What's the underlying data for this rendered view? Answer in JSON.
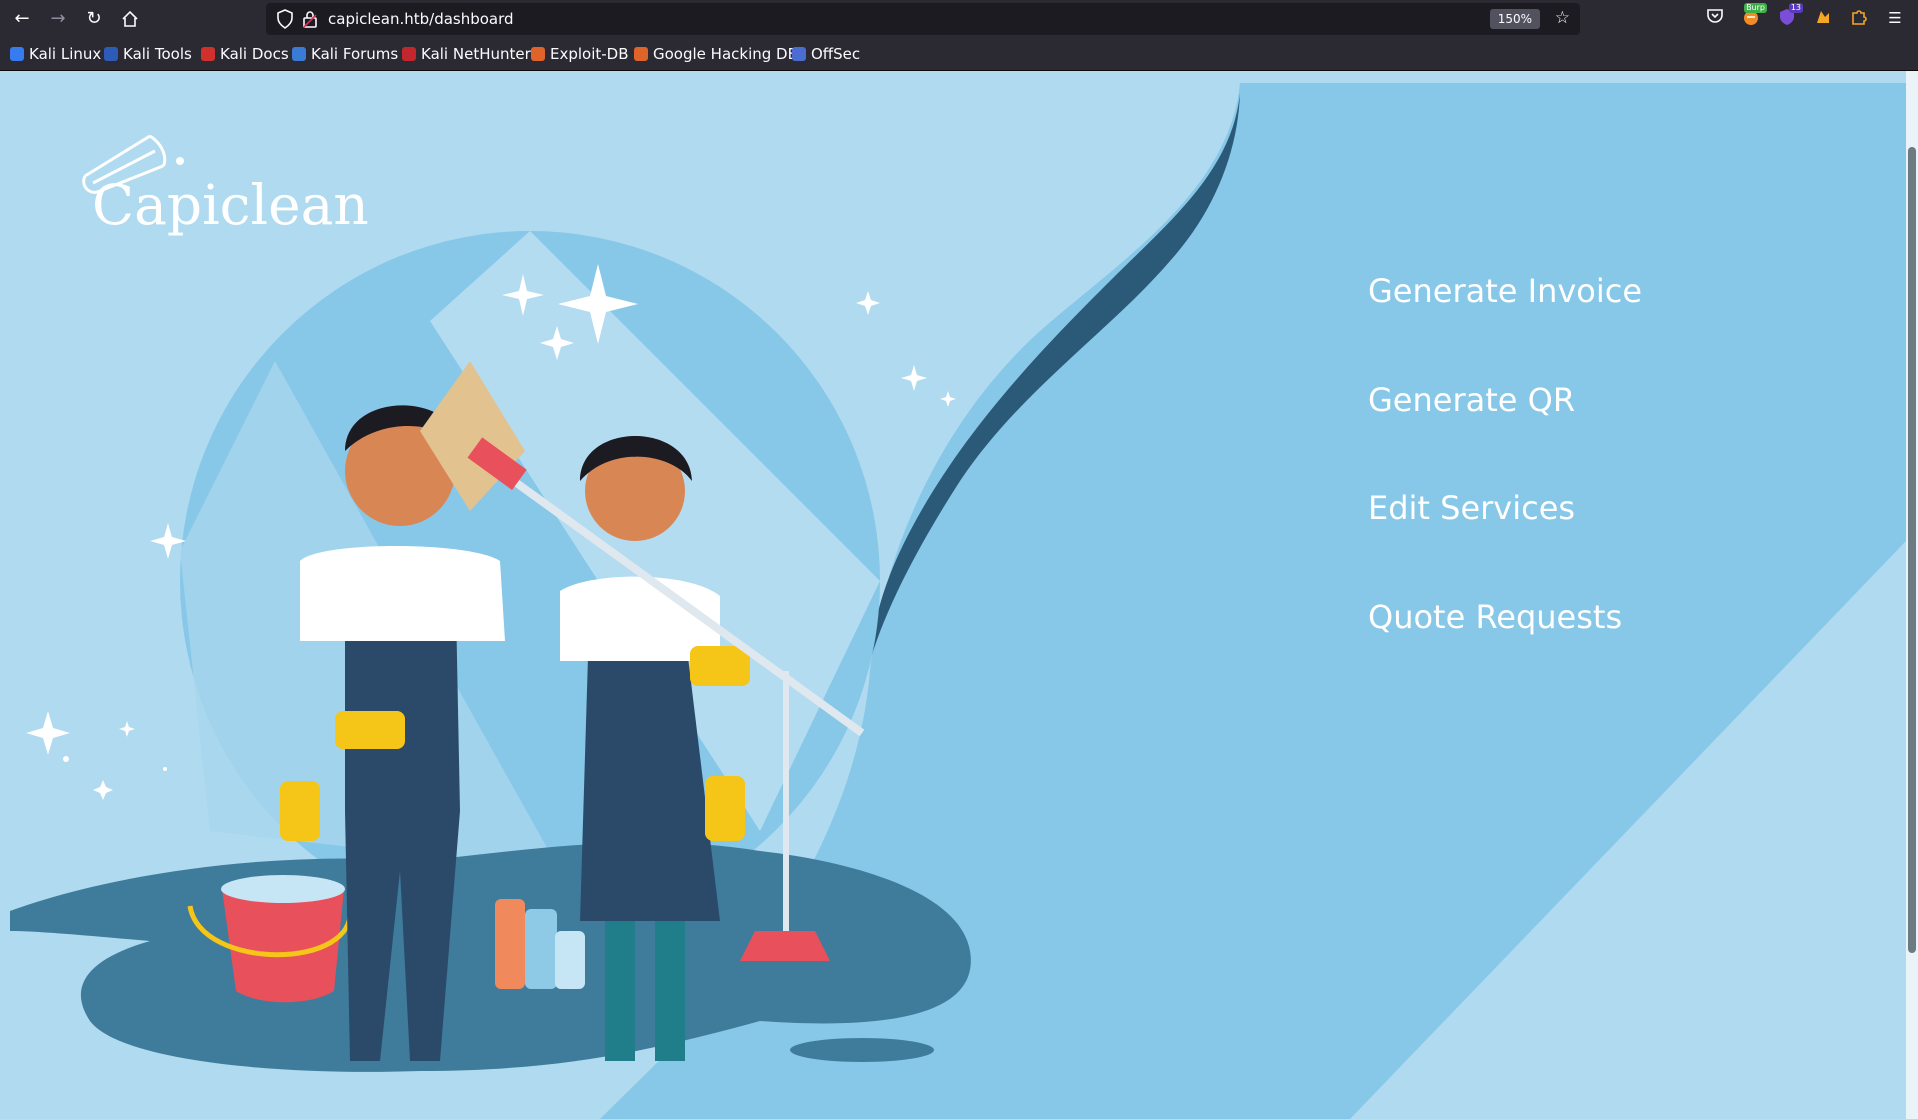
{
  "browser": {
    "url": "capiclean.htb/dashboard",
    "zoom": "150%",
    "extension_badges": {
      "burp": "Burp",
      "ublock": "13"
    },
    "bookmarks": [
      {
        "label": "Kali Linux",
        "color": "#367bf0"
      },
      {
        "label": "Kali Tools",
        "color": "#2d5cb8"
      },
      {
        "label": "Kali Docs",
        "color": "#d0312d"
      },
      {
        "label": "Kali Forums",
        "color": "#3a7bd5"
      },
      {
        "label": "Kali NetHunter",
        "color": "#c1272d"
      },
      {
        "label": "Exploit-DB",
        "color": "#e0632a"
      },
      {
        "label": "Google Hacking DB",
        "color": "#e0632a"
      },
      {
        "label": "OffSec",
        "color": "#4b6cd1"
      }
    ]
  },
  "site": {
    "logo_text": "Capiclean",
    "menu": [
      {
        "label": "Generate Invoice"
      },
      {
        "label": "Generate QR"
      },
      {
        "label": "Edit Services"
      },
      {
        "label": "Quote Requests"
      }
    ]
  },
  "colors": {
    "page_bg": "#afdaef",
    "panel_bg": "#87c7e8",
    "dark_wave": "#2b5a79",
    "floor": "#3f7c9b"
  }
}
